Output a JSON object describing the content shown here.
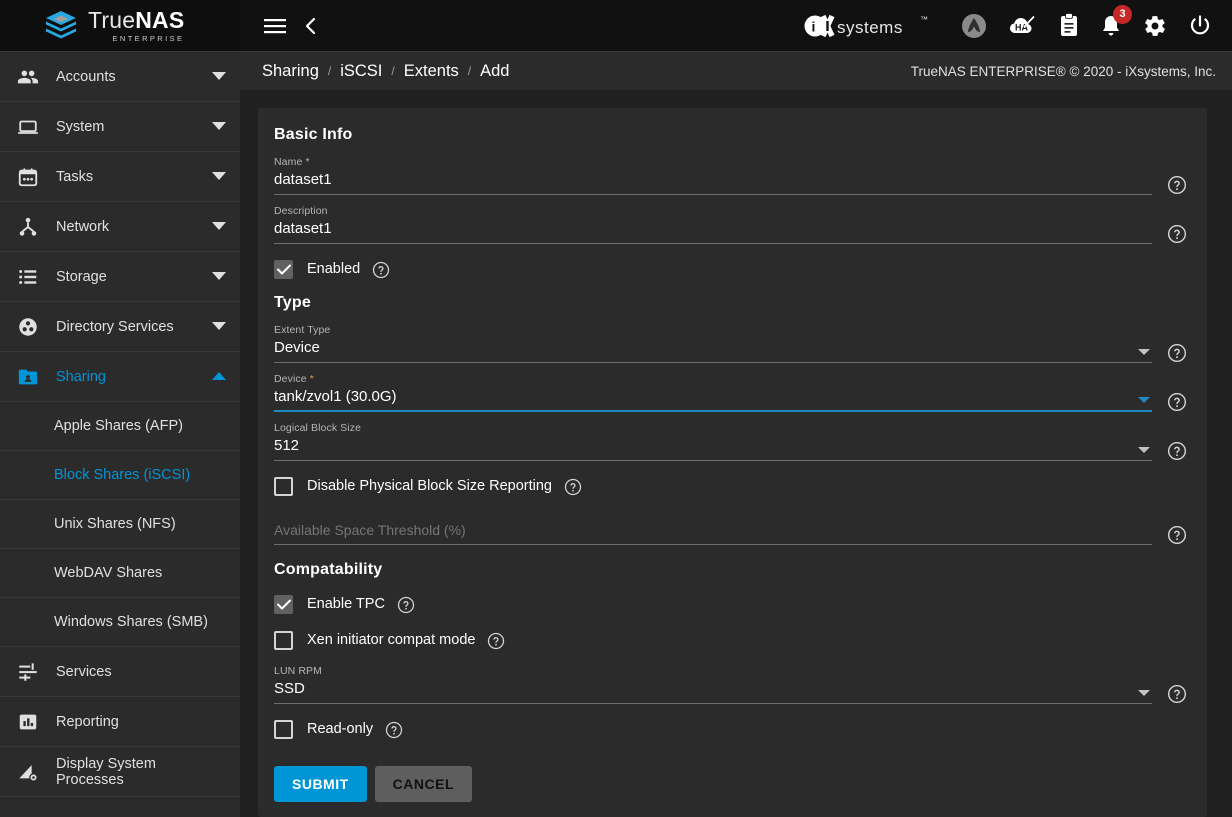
{
  "brand": {
    "product": "TrueNAS",
    "product_light": "True",
    "product_bold": "NAS",
    "edition": "ENTERPRISE",
    "vendor": "iXsystems",
    "accent_blue": "#0095D5",
    "logo_cube_color": "#25A9E0"
  },
  "topbar": {
    "menu_icon": "hamburger-menu-icon",
    "back_icon": "chevron-left-icon",
    "icons": [
      {
        "name": "truecommand-icon",
        "label": "TrueCommand"
      },
      {
        "name": "ha-disabled-icon",
        "label": "HA"
      },
      {
        "name": "jobs-clipboard-icon",
        "label": "Jobs"
      },
      {
        "name": "notifications-bell-icon",
        "label": "Notifications",
        "badge": "3",
        "badge_color": "#c62828"
      },
      {
        "name": "settings-gear-icon",
        "label": "Settings"
      },
      {
        "name": "power-icon",
        "label": "Power"
      }
    ]
  },
  "sidebar": {
    "items": [
      {
        "label": "Accounts",
        "icon": "people-icon",
        "expandable": true,
        "expanded": false,
        "active": false
      },
      {
        "label": "System",
        "icon": "laptop-icon",
        "expandable": true,
        "expanded": false,
        "active": false
      },
      {
        "label": "Tasks",
        "icon": "calendar-icon",
        "expandable": true,
        "expanded": false,
        "active": false
      },
      {
        "label": "Network",
        "icon": "network-tree-icon",
        "expandable": true,
        "expanded": false,
        "active": false
      },
      {
        "label": "Storage",
        "icon": "storage-list-icon",
        "expandable": true,
        "expanded": false,
        "active": false
      },
      {
        "label": "Directory Services",
        "icon": "directory-services-icon",
        "expandable": true,
        "expanded": false,
        "active": false
      },
      {
        "label": "Sharing",
        "icon": "shared-folder-icon",
        "expandable": true,
        "expanded": true,
        "active": true
      }
    ],
    "sharing_children": [
      {
        "label": "Apple Shares (AFP)",
        "active": false
      },
      {
        "label": "Block Shares (iSCSI)",
        "active": true
      },
      {
        "label": "Unix Shares (NFS)",
        "active": false
      },
      {
        "label": "WebDAV Shares",
        "active": false
      },
      {
        "label": "Windows Shares (SMB)",
        "active": false
      }
    ],
    "tail_items": [
      {
        "label": "Services",
        "icon": "sliders-icon"
      },
      {
        "label": "Reporting",
        "icon": "bar-chart-icon"
      },
      {
        "label": "Display System Processes",
        "icon": "system-processes-icon"
      }
    ]
  },
  "breadcrumb": {
    "items": [
      "Sharing",
      "iSCSI",
      "Extents",
      "Add"
    ],
    "separator": "/"
  },
  "copyright": "TrueNAS ENTERPRISE® © 2020 - iXsystems, Inc.",
  "form": {
    "sections": {
      "basic_info": "Basic Info",
      "type": "Type",
      "compatability": "Compatability"
    },
    "name": {
      "label": "Name",
      "required_mark": "*",
      "value": "dataset1"
    },
    "description": {
      "label": "Description",
      "value": "dataset1"
    },
    "enabled": {
      "label": "Enabled",
      "checked": true
    },
    "extent_type": {
      "label": "Extent Type",
      "value": "Device"
    },
    "device": {
      "label": "Device",
      "required_mark": "*",
      "value": "tank/zvol1 (30.0G)",
      "focused": true
    },
    "logical_block_size": {
      "label": "Logical Block Size",
      "value": "512"
    },
    "disable_physical_block_size_reporting": {
      "label": "Disable Physical Block Size Reporting",
      "checked": false
    },
    "available_space_threshold": {
      "label": "Available Space Threshold (%)",
      "value": ""
    },
    "enable_tpc": {
      "label": "Enable TPC",
      "checked": true
    },
    "xen_initiator": {
      "label": "Xen initiator compat mode",
      "checked": false
    },
    "lun_rpm": {
      "label": "LUN RPM",
      "value": "SSD"
    },
    "read_only": {
      "label": "Read-only",
      "checked": false
    },
    "submit_label": "SUBMIT",
    "cancel_label": "CANCEL"
  }
}
